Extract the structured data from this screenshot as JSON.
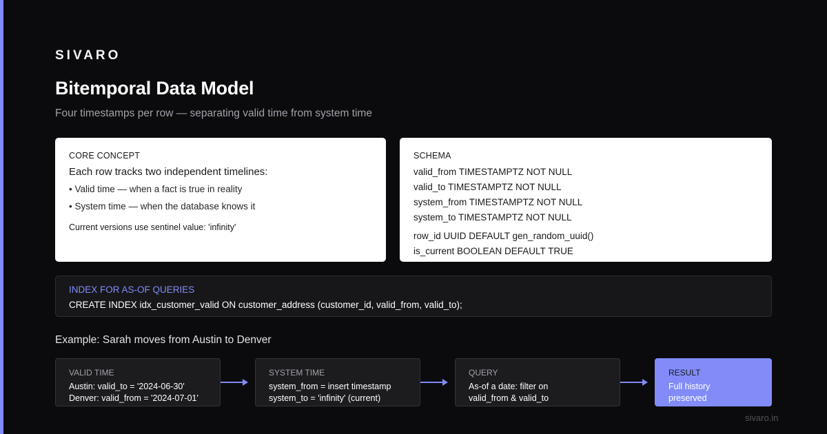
{
  "brand": "SIVARO",
  "title": "Bitemporal Data Model",
  "subtitle": "Four timestamps per row — separating valid time from system time",
  "core_concept": {
    "label": "CORE CONCEPT",
    "lead": "Each row tracks two independent timelines:",
    "bullets": [
      "• Valid time — when a fact is true in reality",
      "• System time — when the database knows it"
    ],
    "note": "Current versions use sentinel value: 'infinity'"
  },
  "schema": {
    "label": "SCHEMA",
    "lines": [
      "valid_from TIMESTAMPTZ NOT NULL",
      "valid_to TIMESTAMPTZ NOT NULL",
      "system_from TIMESTAMPTZ NOT NULL",
      "system_to TIMESTAMPTZ NOT NULL",
      "row_id UUID DEFAULT gen_random_uuid()",
      "is_current BOOLEAN DEFAULT TRUE"
    ]
  },
  "index": {
    "label": "INDEX FOR AS-OF QUERIES",
    "code": "CREATE INDEX idx_customer_valid ON customer_address (customer_id, valid_from, valid_to);"
  },
  "example": {
    "title": "Example: Sarah moves from Austin to Denver",
    "steps": [
      {
        "label": "VALID TIME",
        "lines": [
          "Austin: valid_to = '2024-06-30'",
          "Denver: valid_from = '2024-07-01'"
        ]
      },
      {
        "label": "SYSTEM TIME",
        "lines": [
          "system_from = insert timestamp",
          "system_to = 'infinity' (current)"
        ]
      },
      {
        "label": "QUERY",
        "lines": [
          "As-of a date: filter on",
          "valid_from & valid_to"
        ]
      },
      {
        "label": "RESULT",
        "lines": [
          "Full history",
          "preserved"
        ]
      }
    ]
  },
  "footer": "sivaro.in",
  "colors": {
    "accent": "#818cf8",
    "background": "#0b0b0d",
    "card": "#ffffff",
    "panel": "#1c1c1f"
  }
}
